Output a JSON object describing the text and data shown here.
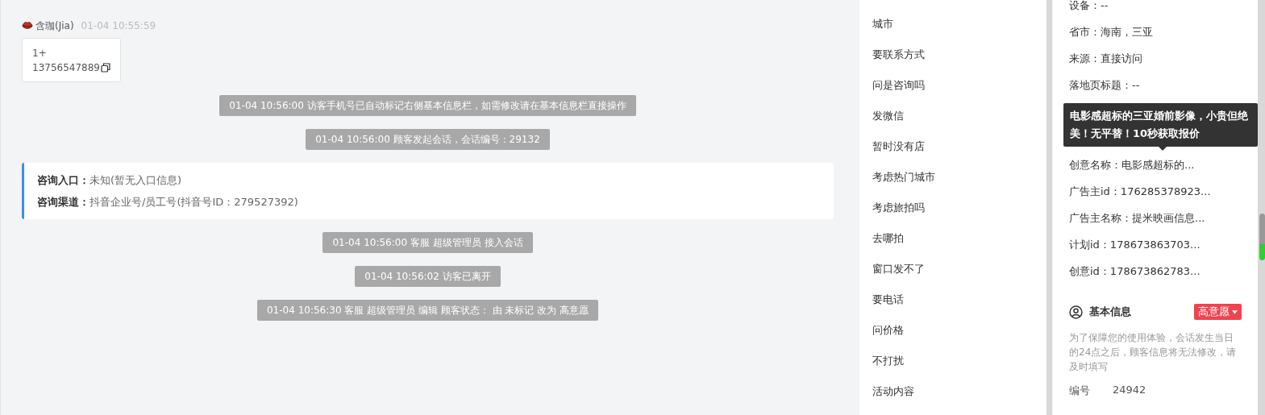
{
  "chat": {
    "sender": {
      "name": "含珈(Jia)",
      "time": "01-04 10:55:59"
    },
    "bubble": {
      "lines": [
        "1+",
        "13756547889"
      ]
    },
    "messages": [
      {
        "kind": "system",
        "text": "01-04 10:56:00 访客手机号已自动标记右侧基本信息栏，如需修改请在基本信息栏直接操作"
      },
      {
        "kind": "system",
        "text": "01-04 10:56:00 顾客发起会话，会话编号：29132"
      },
      {
        "kind": "card",
        "rows": [
          {
            "label": "咨询入口：",
            "value": "未知(暂无入口信息)"
          },
          {
            "label": "咨询渠道：",
            "value": "抖音企业号/员工号(抖音号ID：279527392)"
          }
        ]
      },
      {
        "kind": "system",
        "text": "01-04 10:56:00 客服 超级管理员 接入会话"
      },
      {
        "kind": "system",
        "text": "01-04 10:56:02 访客已离开"
      },
      {
        "kind": "system",
        "text": "01-04 10:56:30 客服 超级管理员 编辑 顾客状态： 由 未标记 改为 高意愿"
      }
    ]
  },
  "tag_list": {
    "items": [
      "城市",
      "要联系方式",
      "问是咨询吗",
      "发微信",
      "暂时没有店",
      "考虑热门城市",
      "考虑旅拍吗",
      "去哪拍",
      "窗口发不了",
      "要电话",
      "问价格",
      "不打扰",
      "活动内容"
    ]
  },
  "details": {
    "rows_above": [
      {
        "text": "设备：--"
      },
      {
        "text": "省市：海南，三亚"
      },
      {
        "text": "来源：直接访问"
      },
      {
        "text": "落地页标题：--"
      }
    ],
    "rows_below": [
      {
        "text": "创意名称：电影感超标的..."
      },
      {
        "text": "广告主id：176285378923..."
      },
      {
        "text": "广告主名称：提米映画信息..."
      },
      {
        "text": "计划id：178673863703..."
      },
      {
        "text": "创意id：178673862783..."
      }
    ],
    "tooltip": "电影感超标的三亚婚前影像，小贵但绝美！无平替！10秒获取报价",
    "basic_info": {
      "title": "基本信息",
      "status": "高意愿",
      "note": "为了保障您的使用体验，会话发生当日的24点之后，顾客信息将无法修改，请及时填写",
      "fields": [
        {
          "label": "编号",
          "value": "24942"
        }
      ]
    }
  }
}
